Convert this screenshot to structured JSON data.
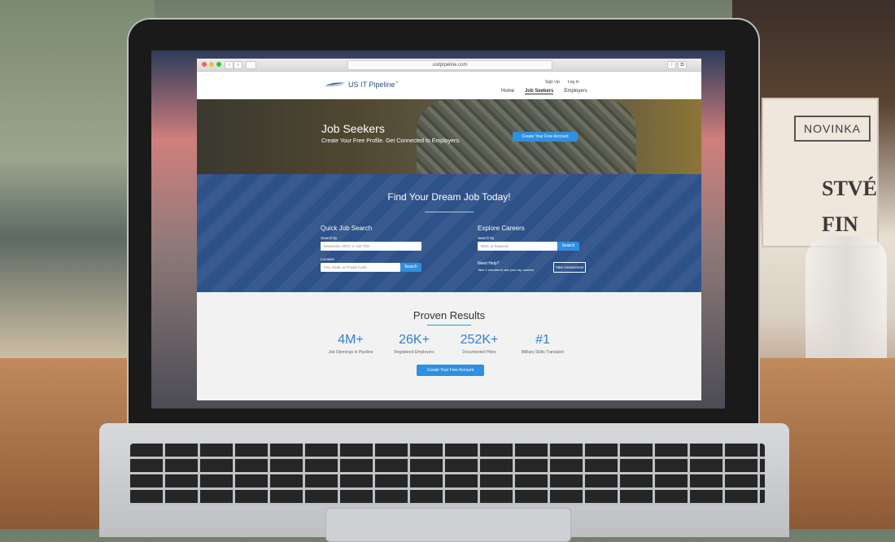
{
  "browser": {
    "url": "usitpipeline.com",
    "back_icon": "chevron-left-icon",
    "forward_icon": "chevron-right-icon"
  },
  "site": {
    "logo_text": "US IT Pipeline",
    "logo_mark": "™",
    "top_links": [
      "Sign Up",
      "Log In"
    ],
    "nav": [
      "Home",
      "Job Seekers",
      "Employers"
    ],
    "active_nav": "Job Seekers"
  },
  "hero": {
    "title": "Job Seekers",
    "subtitle": "Create Your Free Profile. Get Connected to Employers.",
    "cta_label": "Create Your Free Account"
  },
  "search": {
    "title": "Find Your Dream Job Today!",
    "quick": {
      "title": "Quick Job Search",
      "search_by_label": "Search by",
      "search_by_placeholder": "Keywords, MOC or Job Title",
      "location_label": "Location",
      "location_placeholder": "City, State, or Postal Code",
      "button": "Search"
    },
    "explore": {
      "title": "Explore Careers",
      "search_by_label": "Search by",
      "search_by_placeholder": "MOC or keyword",
      "button": "Search",
      "help_title": "Need Help?",
      "help_text": "Take 2 minutes to see your top careers.",
      "assessment_button": "Take Assessment"
    }
  },
  "results": {
    "title": "Proven Results",
    "stats": [
      {
        "value": "4M+",
        "label": "Job Openings in Pipeline"
      },
      {
        "value": "26K+",
        "label": "Registered Employers"
      },
      {
        "value": "252K+",
        "label": "Documented Hires"
      },
      {
        "value": "#1",
        "label": "Military Skills Translator"
      }
    ],
    "cta_label": "Create Your Free Account"
  },
  "scene": {
    "card_tag": "NOVINKA",
    "card_text": [
      "STVÉ",
      "FIN"
    ]
  },
  "colors": {
    "brand_blue": "#2d5189",
    "accent_blue": "#2f8fe0"
  }
}
